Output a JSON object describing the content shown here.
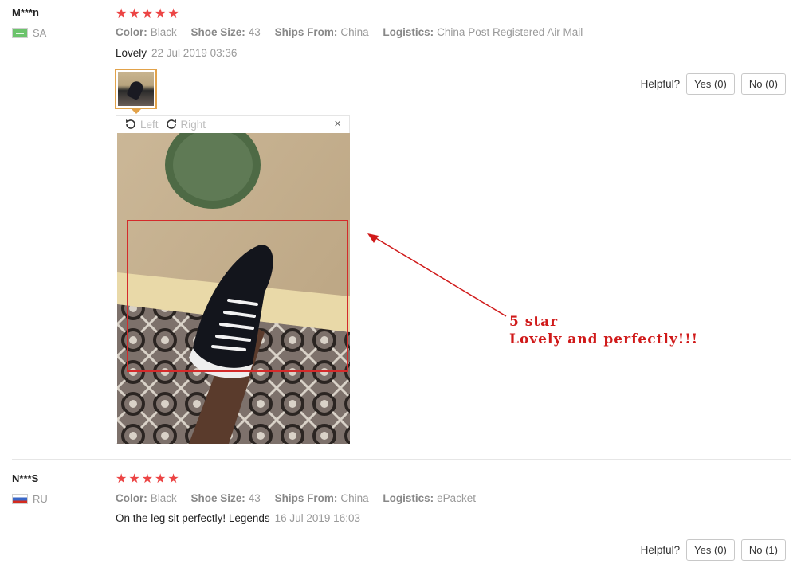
{
  "reviews": [
    {
      "user": "M***n",
      "country": "SA",
      "stars": 5,
      "attributes": [
        {
          "key": "Color:",
          "value": "Black"
        },
        {
          "key": "Shoe Size:",
          "value": "43"
        },
        {
          "key": "Ships From:",
          "value": "China"
        },
        {
          "key": "Logistics:",
          "value": "China Post Registered Air Mail"
        }
      ],
      "text": "Lovely",
      "date": "22 Jul 2019 03:36",
      "helpful_label": "Helpful?",
      "yes_label": "Yes (0)",
      "no_label": "No (0)"
    },
    {
      "user": "N***S",
      "country": "RU",
      "stars": 5,
      "attributes": [
        {
          "key": "Color:",
          "value": "Black"
        },
        {
          "key": "Shoe Size:",
          "value": "43"
        },
        {
          "key": "Ships From:",
          "value": "China"
        },
        {
          "key": "Logistics:",
          "value": "ePacket"
        }
      ],
      "text": "On the leg sit perfectly! Legends",
      "date": "16 Jul 2019 16:03",
      "helpful_label": "Helpful?",
      "yes_label": "Yes (0)",
      "no_label": "No (1)"
    }
  ],
  "viewer": {
    "rotate_left_label": "Left",
    "rotate_right_label": "Right",
    "close_glyph": "×"
  },
  "annotation": {
    "line1": "5 star",
    "line2": "Lovely and perfectly!!!"
  },
  "colors": {
    "star": "#ec4545",
    "annotation": "#d01a1a",
    "thumb_border": "#e2a24a"
  },
  "icons": [
    "flag-sa-icon",
    "flag-ru-icon",
    "star-icon",
    "rotate-left-icon",
    "rotate-right-icon",
    "close-icon"
  ]
}
